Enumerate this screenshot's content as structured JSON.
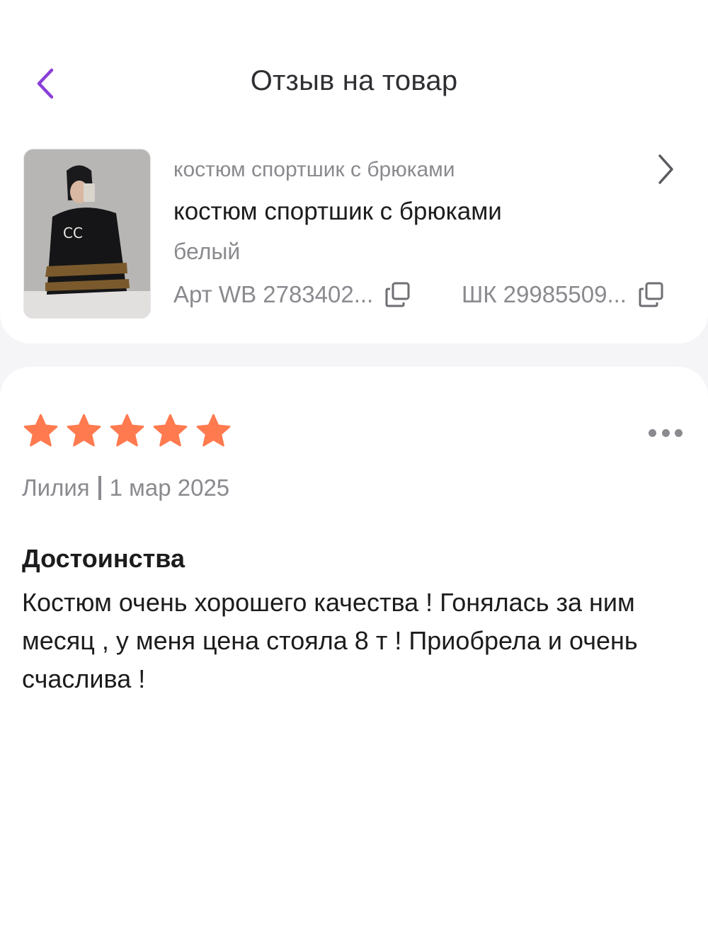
{
  "header": {
    "title": "Отзыв на товар",
    "back_icon": "chevron-left-icon"
  },
  "product": {
    "brand": "костюм спортшик с брюками",
    "name": "костюм спортшик с брюками",
    "color": "белый",
    "article_label": "Арт WB 2783402...",
    "barcode_label": "ШК 29985509...",
    "thumbnail": "product-photo"
  },
  "review": {
    "rating": 5,
    "rating_max": 5,
    "author": "Лилия",
    "date": "1 мар 2025",
    "section_title": "Достоинства",
    "text": "Костюм очень хорошего качества ! Гонялась за ним месяц , у меня цена стояла 8 т ! Приобрела и очень счаслива !"
  },
  "colors": {
    "accent": "#8b3fd9",
    "star": "#ff7a4f",
    "muted": "#8a8a8f"
  }
}
